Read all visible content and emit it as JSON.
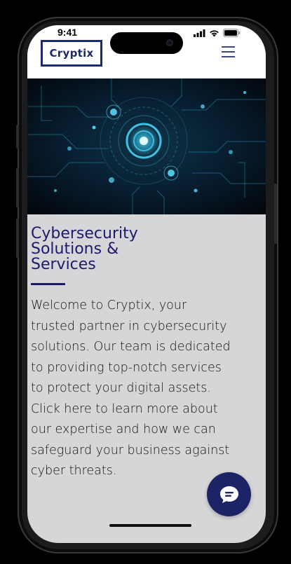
{
  "status_bar": {
    "time": "9:41",
    "icons": [
      "cellular-signal-icon",
      "wifi-icon",
      "battery-icon"
    ]
  },
  "header": {
    "logo_text": "Cryptix",
    "menu_icon": "hamburger-menu-icon"
  },
  "hero": {
    "image_semantic": "cybersecurity-digital-circuit-image"
  },
  "main": {
    "title_lines": [
      "Cybersecurity",
      "Solutions &",
      "Services"
    ],
    "body_lines": [
      "Welcome to Cryptix, your",
      "trusted partner in cybersecurity",
      "solutions. Our team is dedicated",
      "to providing top-notch services",
      "to protect your digital assets.",
      "Click here to learn more about",
      "our expertise and how we can",
      "safeguard your business against",
      "cyber threats."
    ]
  },
  "chat": {
    "icon": "chat-bubble-icon"
  },
  "colors": {
    "brand_navy": "#1d2a6b",
    "title_color": "#1e1a6b",
    "chat_button_bg": "#1c2466",
    "content_bg": "#d6d6d8",
    "hero_glow": "#38d4ff"
  }
}
